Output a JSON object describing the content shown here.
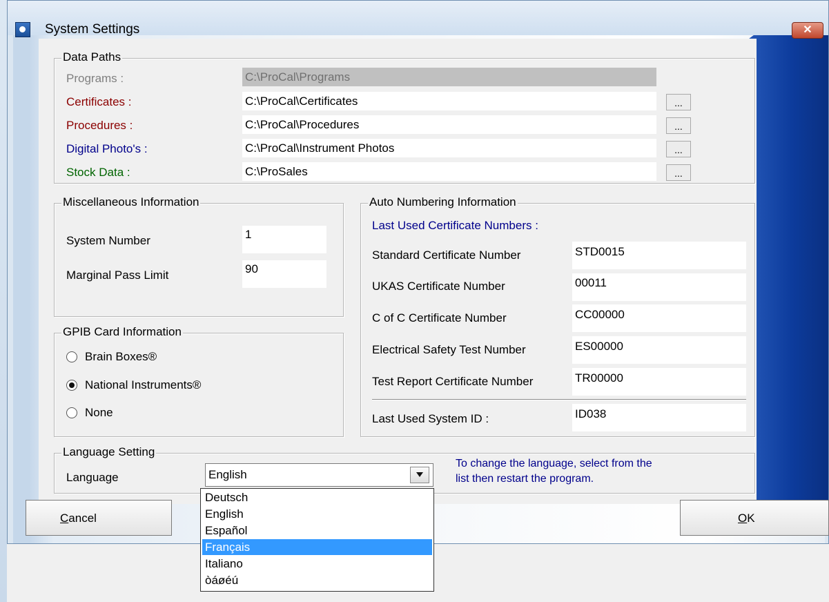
{
  "window": {
    "title": "System Settings",
    "close_symbol": "✕"
  },
  "data_paths": {
    "legend": "Data Paths",
    "rows": [
      {
        "label": "Programs :",
        "value": "C:\\ProCal\\Programs",
        "color": "#808080"
      },
      {
        "label": "Certificates :",
        "value": "C:\\ProCal\\Certificates",
        "color": "#8b0000"
      },
      {
        "label": "Procedures :",
        "value": "C:\\ProCal\\Procedures",
        "color": "#8b0000"
      },
      {
        "label": "Digital Photo's :",
        "value": "C:\\ProCal\\Instrument Photos",
        "color": "#00008b"
      },
      {
        "label": "Stock Data :",
        "value": "C:\\ProSales",
        "color": "#006400"
      }
    ],
    "browse_label": "..."
  },
  "misc": {
    "legend": "Miscellaneous Information",
    "system_number_label": "System Number",
    "system_number_value": "1",
    "marginal_pass_label": "Marginal Pass Limit",
    "marginal_pass_value": "90"
  },
  "gpib": {
    "legend": "GPIB Card Information",
    "options": [
      "Brain Boxes®",
      "National Instruments®",
      "None"
    ],
    "selected": "National Instruments®"
  },
  "auto_numbering": {
    "legend": "Auto Numbering Information",
    "subtitle": "Last Used Certificate Numbers :",
    "rows": [
      {
        "label": "Standard Certificate Number",
        "value": "STD0015"
      },
      {
        "label": "UKAS Certificate Number",
        "value": "00011"
      },
      {
        "label": "C of C Certificate Number",
        "value": "CC00000"
      },
      {
        "label": "Electrical Safety Test Number",
        "value": "ES00000"
      },
      {
        "label": "Test Report Certificate Number",
        "value": "TR00000"
      }
    ],
    "system_id_label": "Last Used System ID :",
    "system_id_value": "ID038"
  },
  "language": {
    "legend": "Language Setting",
    "label": "Language",
    "selected": "English",
    "hint_line1": "To change the language, select from the",
    "hint_line2": "list then restart the program.",
    "options": [
      "Deutsch",
      "English",
      "Español",
      "Français",
      "Italiano",
      "òáøéú"
    ],
    "highlighted": "Français"
  },
  "buttons": {
    "cancel_mnemonic": "C",
    "cancel_rest": "ancel",
    "ok_mnemonic": "O",
    "ok_rest": "K"
  },
  "colors": {
    "hint_text": "#00008b",
    "subtitle_text": "#00008b",
    "selection": "#3399ff"
  }
}
